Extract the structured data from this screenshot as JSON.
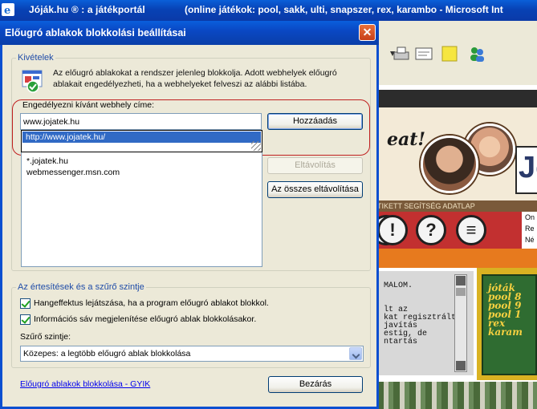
{
  "browser": {
    "title_left": "Jóják.hu ® : a játékportál",
    "title_right": "(online játékok: pool, sakk, ulti, snapszer, rex, karambo - Microsoft Int",
    "page_text_eat": "eat!",
    "page_logo": "Jó",
    "page_nav": "TIKETT SEGÍTSÉG ADATLAP",
    "page_side": [
      "On",
      "Re",
      "Né"
    ],
    "page_body_lines": [
      "MALOM.",
      "",
      "",
      "lt az",
      "kat regisztrált",
      " javítás",
      " estig, de",
      "ntartás"
    ],
    "page_card_lines": [
      "jóták",
      "pool 8",
      "pool 9",
      "pool 1",
      "rex",
      "karam"
    ]
  },
  "dialog": {
    "title": "Előugró ablakok blokkolási beállításai",
    "close_label": "✕",
    "exceptions": {
      "group_label": "Kivételek",
      "info_text": "Az előugró ablakokat a rendszer jelenleg blokkolja. Adott webhelyek előugró ablakait engedélyezheti, ha a webhelyeket felveszi az alábbi listába.",
      "address_label": "Engedélyezni kívánt webhely címe:",
      "address_value": "www.jojatek.hu",
      "autocomplete_item": "http://www.jojatek.hu/",
      "allowed_sites": [
        "*.jojatek.hu",
        "webmessenger.msn.com"
      ],
      "add_button": "Hozzáadás",
      "remove_button": "Eltávolítás",
      "remove_all_button": "Az összes eltávolítása"
    },
    "notifications": {
      "group_label": "Az értesítések és a szűrő szintje",
      "play_sound_label": "Hangeffektus lejátszása, ha a program előugró ablakot blokkol.",
      "play_sound_checked": true,
      "info_bar_label": "Információs sáv megjelenítése előugró ablak blokkolásakor.",
      "info_bar_checked": true,
      "filter_label": "Szűrő szintje:",
      "filter_value": "Közepes: a legtöbb előugró ablak blokkolása"
    },
    "faq_link": "Előugró ablakok blokkolása - GYIK",
    "close_button": "Bezárás"
  },
  "colors": {
    "titlebar": "#0a48c4",
    "group_label": "#1f4ca8",
    "highlight": "#316ac5",
    "annotation_ring": "#c02020"
  }
}
